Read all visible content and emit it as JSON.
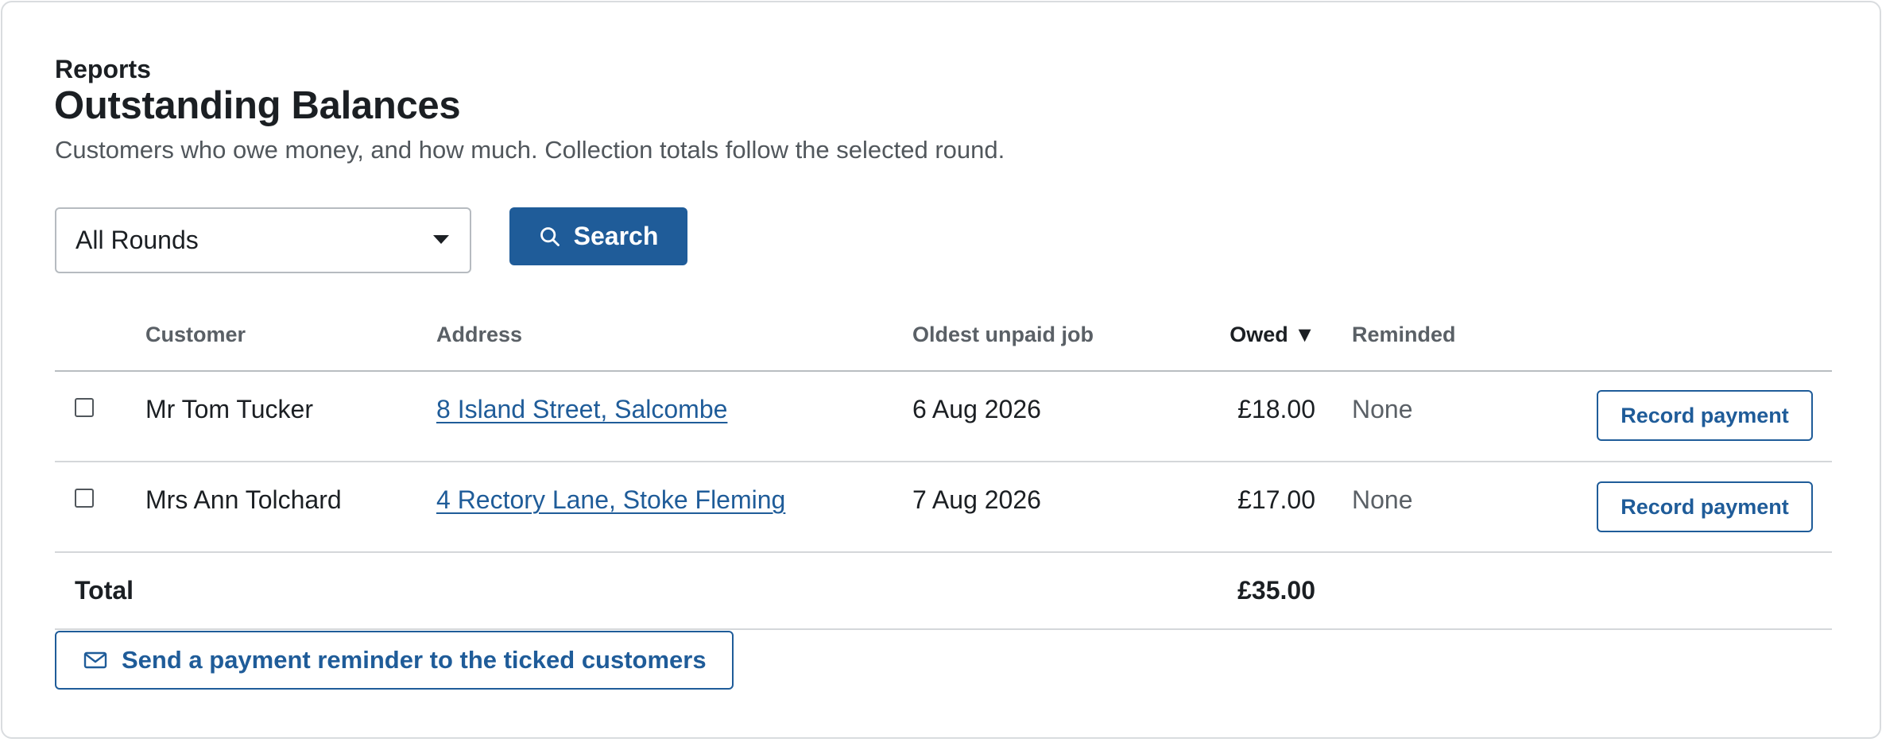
{
  "header": {
    "eyebrow": "Reports",
    "title": "Outstanding Balances",
    "subtitle": "Customers who owe money, and how much. Collection totals follow the selected round."
  },
  "filters": {
    "round_selected": "All Rounds",
    "search_label": "Search"
  },
  "table": {
    "columns": {
      "customer": "Customer",
      "address": "Address",
      "oldest": "Oldest unpaid job",
      "owed": "Owed ▼",
      "reminded": "Reminded"
    },
    "rows": [
      {
        "customer": "Mr Tom Tucker",
        "address": "8 Island Street, Salcombe",
        "oldest": "6 Aug 2026",
        "owed": "£18.00",
        "reminded": "None",
        "action": "Record payment",
        "checked": false
      },
      {
        "customer": "Mrs Ann Tolchard",
        "address": "4 Rectory Lane, Stoke Fleming",
        "oldest": "7 Aug 2026",
        "owed": "£17.00",
        "reminded": "None",
        "action": "Record payment",
        "checked": false
      }
    ],
    "total_label": "Total",
    "total_value": "£35.00"
  },
  "actions": {
    "send_reminder_label": "Send a payment reminder to the ticked customers"
  },
  "colors": {
    "accent": "#1f5c99",
    "text": "#1b1f23",
    "muted": "#5a6066"
  },
  "icons": {
    "search": "search-icon",
    "select_caret": "chevron-down-icon",
    "reminder": "envelope-icon"
  }
}
